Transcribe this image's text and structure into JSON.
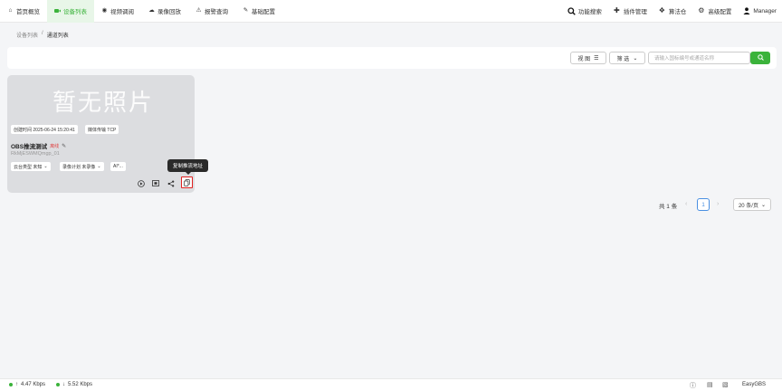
{
  "nav": {
    "items": [
      {
        "label": "首页概览",
        "icon": "home-icon"
      },
      {
        "label": "设备列表",
        "icon": "video-icon",
        "active": true
      },
      {
        "label": "视频调阅",
        "icon": "play-circle-icon"
      },
      {
        "label": "录像回放",
        "icon": "cloud-icon"
      },
      {
        "label": "报警查询",
        "icon": "alarm-icon"
      },
      {
        "label": "基础配置",
        "icon": "edit-icon"
      }
    ],
    "right": [
      {
        "label": "功能搜索",
        "icon": "search-icon"
      },
      {
        "label": "插件管理",
        "icon": "puzzle-icon"
      },
      {
        "label": "算法仓",
        "icon": "box-icon"
      },
      {
        "label": "高级配置",
        "icon": "gear-icon"
      },
      {
        "label": "Manager",
        "icon": "user-icon"
      }
    ],
    "accent": "#3bb33b"
  },
  "breadcrumb": {
    "parent": "设备列表",
    "sep": "/",
    "current": "通道列表"
  },
  "toolbar": {
    "view_label": "视 图",
    "filter_label": "筛 选",
    "search_placeholder": "请输入国标编号或通道名称"
  },
  "card": {
    "placeholder_text": "暂无照片",
    "created_tag": "创建时间 2025-06-24 15:20:41",
    "transport_tag": "媒体传输 TCP",
    "name": "OBS推流测试",
    "status": "离线",
    "device_id": "RkMjESWMQmgp_01",
    "ptz_chip": "云台类型 未知",
    "record_chip": "录像计划 未录像",
    "ai_chip": "AI*..."
  },
  "tooltip": "复制推流地址",
  "pager": {
    "total": "共 1 条",
    "page": "1",
    "size": "20 条/页"
  },
  "footer": {
    "upload": "4.47 Kbps",
    "download": "5.52 Kbps",
    "brand": "EasyGBS"
  }
}
